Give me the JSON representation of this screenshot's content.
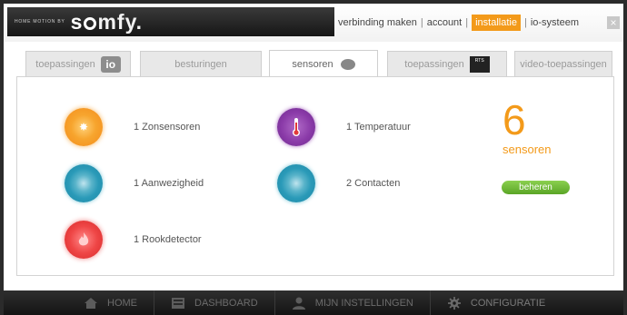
{
  "logo": {
    "tagline": "HOME MOTION BY",
    "brand_prefix": "s",
    "brand_suffix": "mfy."
  },
  "top_nav": {
    "items": [
      {
        "label": "verbinding maken"
      },
      {
        "label": "account"
      },
      {
        "label": "installatie"
      },
      {
        "label": "io-systeem"
      }
    ],
    "active": "installatie",
    "close_label": "×"
  },
  "tabs": [
    {
      "label": "toepassingen",
      "badge": "io"
    },
    {
      "label": "besturingen"
    },
    {
      "label": "sensoren"
    },
    {
      "label": "toepassingen",
      "badge": "RTS"
    },
    {
      "label": "video-toepassingen"
    }
  ],
  "active_tab": "sensoren",
  "sensors": [
    {
      "label": "1 Zonsensoren",
      "icon": "sun-sensor-icon"
    },
    {
      "label": "1 Temperatuur",
      "icon": "thermometer-icon"
    },
    {
      "label": "1 Aanwezigheid",
      "icon": "presence-sensor-icon"
    },
    {
      "label": "2 Contacten",
      "icon": "contact-sensor-icon"
    },
    {
      "label": "1 Rookdetector",
      "icon": "smoke-detector-icon"
    }
  ],
  "summary": {
    "count": "6",
    "count_label": "sensoren",
    "manage_label": "beheren"
  },
  "bottom_nav": [
    {
      "label": "HOME",
      "icon": "home-icon"
    },
    {
      "label": "DASHBOARD",
      "icon": "dashboard-icon"
    },
    {
      "label": "MIJN INSTELLINGEN",
      "icon": "user-icon"
    },
    {
      "label": "CONFIGURATIE",
      "icon": "gear-icon"
    }
  ],
  "colors": {
    "accent_orange": "#f39a1a",
    "button_green": "#6ab52f",
    "sun": "#f7a52e",
    "temperature": "#8a3aa8",
    "presence_contact": "#2a9ab8",
    "smoke": "#ef4646"
  }
}
